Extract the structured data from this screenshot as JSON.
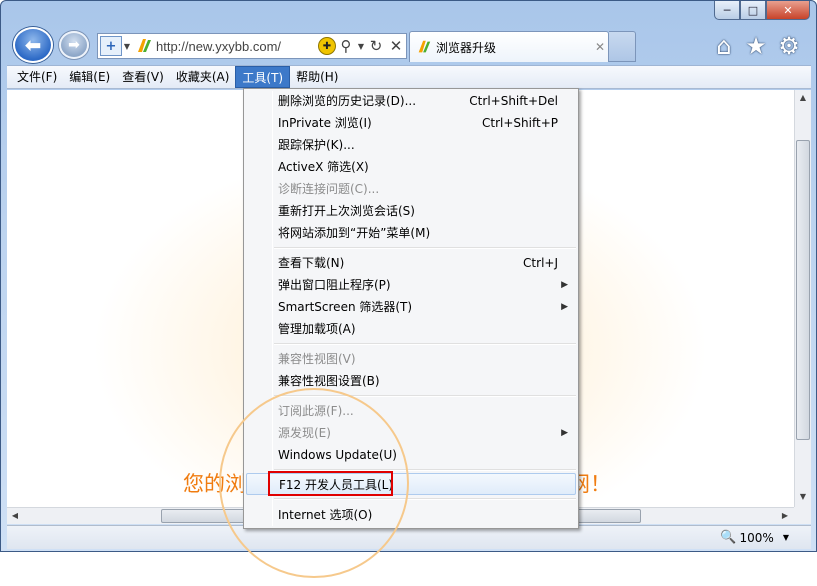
{
  "window": {
    "minimize_glyph": "─",
    "maximize_glyph": "□",
    "close_glyph": "✕"
  },
  "nav": {
    "back_glyph": "⬅",
    "forward_glyph": "➡"
  },
  "address_bar": {
    "url": "http://new.yxybb.com/",
    "search_glyph": "⚲",
    "refresh_glyph": "↻",
    "stop_glyph": "✕"
  },
  "tab": {
    "title": "浏览器升级",
    "close_glyph": "✕"
  },
  "toolbar": {
    "home_glyph": "⌂",
    "favorites_glyph": "★",
    "tools_glyph": "⚙"
  },
  "menubar": {
    "items": [
      {
        "label": "文件(F)"
      },
      {
        "label": "编辑(E)"
      },
      {
        "label": "查看(V)"
      },
      {
        "label": "收藏夹(A)"
      },
      {
        "label": "工具(T)"
      },
      {
        "label": "帮助(H)"
      }
    ]
  },
  "tools_menu": {
    "items": [
      {
        "label": "删除浏览的历史记录(D)...",
        "shortcut": "Ctrl+Shift+Del"
      },
      {
        "label": "InPrivate 浏览(I)",
        "shortcut": "Ctrl+Shift+P"
      },
      {
        "label": "跟踪保护(K)...",
        "shortcut": ""
      },
      {
        "label": "ActiveX 筛选(X)",
        "shortcut": ""
      },
      {
        "label": "诊断连接问题(C)...",
        "shortcut": ""
      },
      {
        "label": "重新打开上次浏览会话(S)",
        "shortcut": ""
      },
      {
        "label": "将网站添加到“开始”菜单(M)",
        "shortcut": ""
      },
      {
        "label": "查看下载(N)",
        "shortcut": "Ctrl+J"
      },
      {
        "label": "弹出窗口阻止程序(P)",
        "shortcut": ""
      },
      {
        "label": "SmartScreen 筛选器(T)",
        "shortcut": ""
      },
      {
        "label": "管理加载项(A)",
        "shortcut": ""
      },
      {
        "label": "兼容性视图(V)",
        "shortcut": ""
      },
      {
        "label": "兼容性视图设置(B)",
        "shortcut": ""
      },
      {
        "label": "订阅此源(F)...",
        "shortcut": ""
      },
      {
        "label": "源发现(E)",
        "shortcut": ""
      },
      {
        "label": "Windows Update(U)",
        "shortcut": ""
      },
      {
        "label": "F12 开发人员工具(L)",
        "shortcut": ""
      },
      {
        "label": "Internet 选项(O)",
        "shortcut": ""
      }
    ],
    "submenu_glyph": "▶"
  },
  "page": {
    "headline_left": "您的浏",
    "headline_right": "网！"
  },
  "status_bar": {
    "zoom": "100%",
    "zoom_glyph": "🔍"
  },
  "colors": {
    "menu_active": "#3d79c9",
    "highlight_box": "#e00000",
    "headline": "#f07c10",
    "ring": "#f6c98c"
  }
}
